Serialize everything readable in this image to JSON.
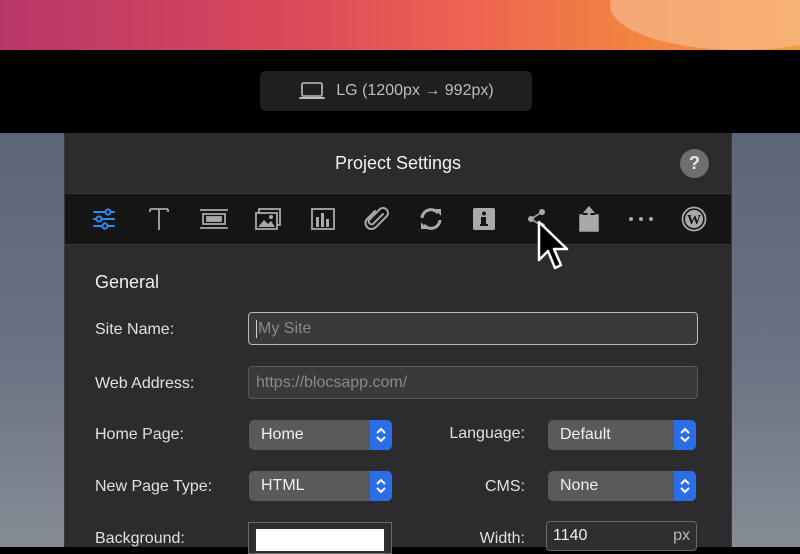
{
  "device": {
    "label": "LG (1200px → 992px)",
    "icon": "laptop-icon"
  },
  "dialog": {
    "title": "Project Settings",
    "help_label": "?"
  },
  "toolbar": {
    "tabs": [
      {
        "name": "sliders-icon",
        "active": true
      },
      {
        "name": "text-icon"
      },
      {
        "name": "layout-icon"
      },
      {
        "name": "images-icon"
      },
      {
        "name": "chart-icon"
      },
      {
        "name": "paperclip-icon"
      },
      {
        "name": "sync-icon"
      },
      {
        "name": "info-icon"
      },
      {
        "name": "share-icon"
      },
      {
        "name": "export-icon"
      },
      {
        "name": "more-icon"
      },
      {
        "name": "wordpress-icon"
      }
    ]
  },
  "general": {
    "section_title": "General",
    "site_name": {
      "label": "Site Name:",
      "placeholder": "My Site",
      "value": ""
    },
    "web_address": {
      "label": "Web Address:",
      "placeholder": "https://blocsapp.com/",
      "value": ""
    },
    "home_page": {
      "label": "Home Page:",
      "value": "Home"
    },
    "language": {
      "label": "Language:",
      "value": "Default"
    },
    "new_page_type": {
      "label": "New Page Type:",
      "value": "HTML"
    },
    "cms": {
      "label": "CMS:",
      "value": "None"
    },
    "background": {
      "label": "Background:",
      "color": "#ffffff"
    },
    "width": {
      "label": "Width:",
      "value": "1140",
      "unit": "px"
    }
  },
  "colors": {
    "accent": "#2a6ee8",
    "panel": "#2c2c2e"
  }
}
